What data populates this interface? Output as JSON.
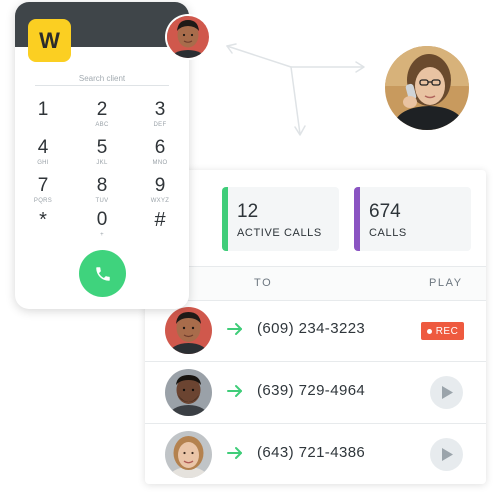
{
  "dialer": {
    "logo_letter": "W",
    "search_placeholder": "Search client",
    "keys": [
      {
        "digit": "1",
        "letters": ""
      },
      {
        "digit": "2",
        "letters": "ABC"
      },
      {
        "digit": "3",
        "letters": "DEF"
      },
      {
        "digit": "4",
        "letters": "GHI"
      },
      {
        "digit": "5",
        "letters": "JKL"
      },
      {
        "digit": "6",
        "letters": "MNO"
      },
      {
        "digit": "7",
        "letters": "PQRS"
      },
      {
        "digit": "8",
        "letters": "TUV"
      },
      {
        "digit": "9",
        "letters": "WXYZ"
      },
      {
        "digit": "*",
        "letters": ""
      },
      {
        "digit": "0",
        "letters": "+"
      },
      {
        "digit": "#",
        "letters": ""
      }
    ],
    "call_icon": "phone-icon"
  },
  "stats": {
    "active": {
      "value": "12",
      "label": "ACTIVE CALLS",
      "color": "#3fcd79"
    },
    "calls": {
      "value": "674",
      "label": "CALLS",
      "color": "#8a54c2"
    }
  },
  "table": {
    "headers": {
      "to": "TO",
      "play": "PLAY"
    },
    "rows": [
      {
        "phone": "(609) 234-3223",
        "status": "recording",
        "badge": "REC"
      },
      {
        "phone": "(639) 729-4964",
        "status": "playable"
      },
      {
        "phone": "(643) 721-4386",
        "status": "playable"
      }
    ]
  },
  "colors": {
    "accent_green": "#3fd37d",
    "rec_red": "#ee5a3f",
    "logo_yellow": "#fbcf22",
    "header_dark": "#3f4549"
  }
}
